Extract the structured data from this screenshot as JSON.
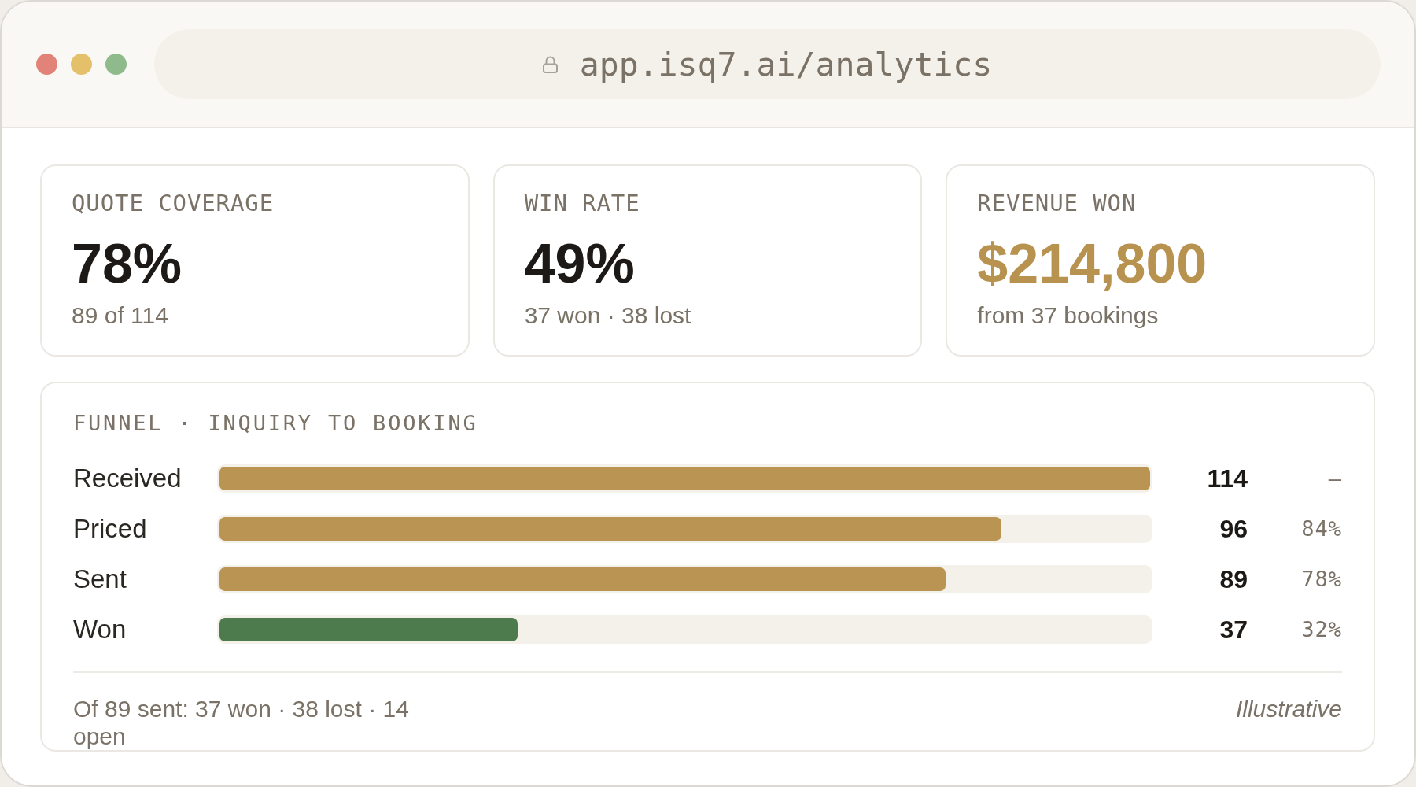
{
  "window": {
    "url": "app.isq7.ai/analytics"
  },
  "metrics": [
    {
      "label": "QUOTE COVERAGE",
      "value": "78%",
      "detail": "89 of 114",
      "color": "#1c1917"
    },
    {
      "label": "WIN RATE",
      "value": "49%",
      "detail": "37 won · 38 lost",
      "color": "#1c1917"
    },
    {
      "label": "REVENUE WON",
      "value": "$214,800",
      "detail": "from 37 bookings",
      "color": "#b8924f"
    }
  ],
  "funnel": {
    "title": "FUNNEL · INQUIRY TO BOOKING",
    "stages": [
      {
        "name": "Received",
        "count": "114",
        "share": "–",
        "level": 1,
        "color": "#ba9452"
      },
      {
        "name": "Priced",
        "count": "96",
        "share": "84%",
        "level": 0.84,
        "color": "#ba9452"
      },
      {
        "name": "Sent",
        "count": "89",
        "share": "78%",
        "level": 0.78,
        "color": "#ba9452"
      },
      {
        "name": "Won",
        "count": "37",
        "share": "32%",
        "level": 0.32,
        "color": "#4e7b4d"
      }
    ],
    "footnote": "Of 89 sent: 37 won · 38 lost · 14 open",
    "note": "Illustrative"
  }
}
